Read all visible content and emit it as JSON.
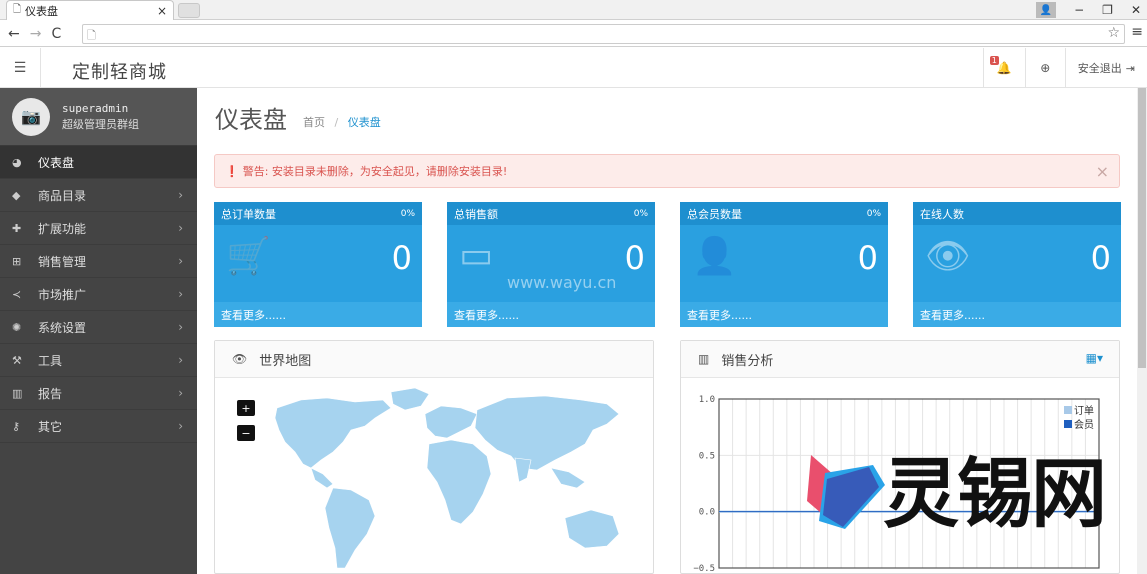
{
  "browser": {
    "tab_title": "仪表盘",
    "tab_close": "×",
    "win_min": "−",
    "win_max": "❐",
    "win_close": "✕"
  },
  "header": {
    "brand": "定制轻商城",
    "bell_badge": "1",
    "logout": "安全退出"
  },
  "sidebar": {
    "username": "superadmin",
    "role": "超级管理员群组",
    "items": [
      {
        "label": "仪表盘",
        "icon": "dashboard-icon",
        "active": true
      },
      {
        "label": "商品目录",
        "icon": "tag-icon"
      },
      {
        "label": "扩展功能",
        "icon": "puzzle-icon"
      },
      {
        "label": "销售管理",
        "icon": "cart-icon"
      },
      {
        "label": "市场推广",
        "icon": "share-icon"
      },
      {
        "label": "系统设置",
        "icon": "gear-icon"
      },
      {
        "label": "工具",
        "icon": "wrench-icon"
      },
      {
        "label": "报告",
        "icon": "bar-chart-icon"
      },
      {
        "label": "其它",
        "icon": "key-icon"
      }
    ]
  },
  "page": {
    "title": "仪表盘",
    "breadcrumb_home": "首页",
    "breadcrumb_sep": "/",
    "breadcrumb_current": "仪表盘",
    "alert": "警告: 安装目录未删除，为安全起见，请删除安装目录!"
  },
  "tiles": [
    {
      "title": "总订单数量",
      "pct": "0%",
      "value": "0",
      "footer": "查看更多......",
      "icon": "cart-icon"
    },
    {
      "title": "总销售额",
      "pct": "0%",
      "value": "0",
      "footer": "查看更多......",
      "icon": "credit-card-icon"
    },
    {
      "title": "总会员数量",
      "pct": "0%",
      "value": "0",
      "footer": "查看更多......",
      "icon": "user-icon"
    },
    {
      "title": "在线人数",
      "pct": "",
      "value": "0",
      "footer": "查看更多......",
      "icon": "eye-icon"
    }
  ],
  "panels": {
    "map_title": "世界地图",
    "zoom_in": "+",
    "zoom_out": "−",
    "sales_title": "销售分析"
  },
  "chart_data": {
    "type": "line",
    "ylim": [
      -0.5,
      1.0
    ],
    "yticks": [
      "1.0",
      "0.5",
      "0.0",
      "−0.5"
    ],
    "series": [
      {
        "name": "订单",
        "color": "#a8c9e8",
        "values": [
          0
        ]
      },
      {
        "name": "会员",
        "color": "#1f5fbf",
        "values": [
          0
        ]
      }
    ]
  },
  "watermarks": {
    "site": "www.wayu.cn",
    "logo": "灵锡网"
  }
}
